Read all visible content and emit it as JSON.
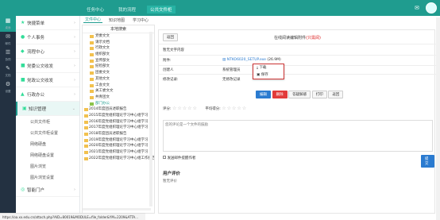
{
  "top_tabs": [
    "任务中心",
    "我的流程",
    "公共文件柜"
  ],
  "rail": [
    {
      "icon": "▦",
      "label": "桌面"
    },
    {
      "icon": "✉",
      "label": "邮件"
    },
    {
      "icon": "☰",
      "label": "协同"
    },
    {
      "icon": "✎",
      "label": "文档"
    },
    {
      "icon": "⚙",
      "label": "设置"
    }
  ],
  "sidebar": {
    "items": [
      {
        "label": "快捷菜单"
      },
      {
        "label": "个人事务"
      },
      {
        "label": "流程中心"
      },
      {
        "label": "党委公文收发"
      },
      {
        "label": "党政公文收发"
      },
      {
        "label": "行政办公"
      },
      {
        "label": "知识管理"
      }
    ],
    "subitems": [
      "公共文件柜",
      "公共文件柜设置",
      "网络硬盘",
      "网络硬盘设置",
      "图片浏览",
      "图片浏览设置"
    ],
    "last_item": "智能门户"
  },
  "subtabs": [
    "文件中心",
    "知识地图",
    "学习中心"
  ],
  "tree": {
    "header": "本地搜索",
    "nodes": [
      "党委文文",
      "请示文档",
      "行政文文",
      "组织部文",
      "宣传部文",
      "纪检部文",
      "团委文文",
      "其他文文",
      "工会文文",
      "关工委文文",
      "共青团文",
      "部门办公",
      "2014年度团员述职报告",
      "2015年度党组织理论学习中心组学习",
      "2016年度党组织理论学习中心组学习",
      "2017年度党组织理论学习中心组学习",
      "2018年度团员述职报告",
      "2019年度党组织理论学习中心组学习",
      "2020年度党组织理论学习中心组学习",
      "2021年度党组织理论学习中心组学习",
      "2022年度党组织理论学习中心组工作报告"
    ]
  },
  "panel": {
    "back": "返回",
    "title": "在线阅读编辑附件",
    "title_red": "(只需阅)",
    "content_label": "暂无文字内容",
    "attach_label": "附件:",
    "attach_name": "NTKO6020_SETUP.exe",
    "attach_size": "(26.9M)",
    "creator_label": "创建人",
    "creator_value": "系统管理员",
    "modify_label": "修改记录:",
    "modify_value": "无修改记录",
    "buttons": [
      "编辑",
      "删除",
      "答疑解惑",
      "打印",
      "返回"
    ],
    "rate_label": "评分:",
    "avg_label": "平均得分:",
    "stars": "☆☆☆☆☆",
    "comment_placeholder": "您的评论是一个文件的鼓励",
    "checkbox_label": "发送邮件提醒作者",
    "submit": "提交",
    "user_eval": "用户评价",
    "no_eval": "暂无评价"
  },
  "popup": {
    "download": "下载",
    "save": "保存"
  },
  "statusbar": "https://oa.xx.edu.cn/attach.php?AID=80019&MODULE=file_folder&YM=2209&ATTA..."
}
